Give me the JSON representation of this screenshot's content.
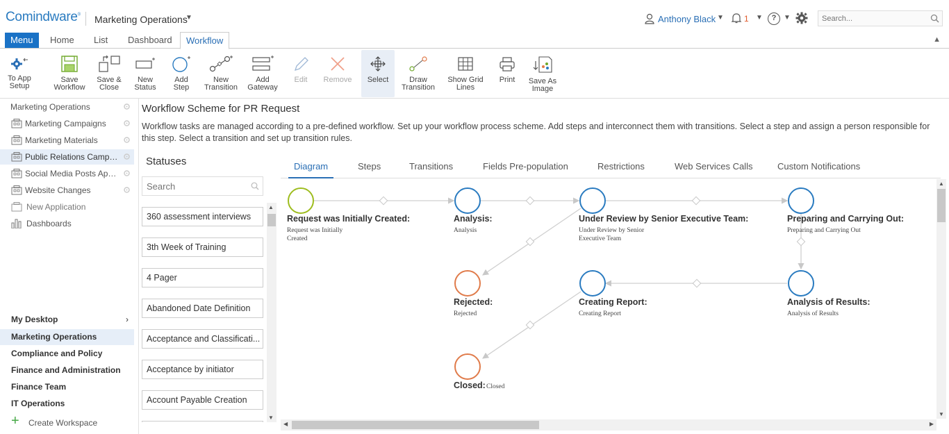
{
  "header": {
    "logo": "Comindware",
    "workspace_title": "Marketing Operations",
    "user_name": "Anthony Black",
    "notifications_count": "1",
    "search_placeholder": "Search..."
  },
  "tabs": {
    "menu": "Menu",
    "home": "Home",
    "list": "List",
    "dashboard": "Dashboard",
    "workflow": "Workflow"
  },
  "toolbar": {
    "to_app_setup_1": "To App",
    "to_app_setup_2": "Setup",
    "save_workflow_1": "Save",
    "save_workflow_2": "Workflow",
    "save_close_1": "Save &",
    "save_close_2": "Close",
    "new_status_1": "New",
    "new_status_2": "Status",
    "add_step_1": "Add",
    "add_step_2": "Step",
    "new_transition_1": "New",
    "new_transition_2": "Transition",
    "add_gateway_1": "Add",
    "add_gateway_2": "Gateway",
    "edit": "Edit",
    "remove": "Remove",
    "select": "Select",
    "draw_transition_1": "Draw",
    "draw_transition_2": "Transition",
    "show_grid_1": "Show Grid",
    "show_grid_2": "Lines",
    "print": "Print",
    "save_image_1": "Save As",
    "save_image_2": "Image"
  },
  "leftnav": {
    "items": [
      {
        "label": "Marketing Operations"
      },
      {
        "label": "Marketing Campaigns"
      },
      {
        "label": "Marketing Materials"
      },
      {
        "label": "Public Relations Campai..."
      },
      {
        "label": "Social Media Posts Appr..."
      },
      {
        "label": "Website Changes"
      },
      {
        "label": "New Application"
      },
      {
        "label": "Dashboards"
      }
    ],
    "workspaces": [
      {
        "label": "My Desktop"
      },
      {
        "label": "Marketing Operations"
      },
      {
        "label": "Compliance and Policy"
      },
      {
        "label": "Finance and Administration"
      },
      {
        "label": "Finance Team"
      },
      {
        "label": "IT Operations"
      }
    ],
    "create_workspace": "Create Workspace"
  },
  "main": {
    "title": "Workflow Scheme for PR Request",
    "description": "Workflow tasks are managed according to a pre-defined workflow. Set up your workflow process scheme. Add steps and interconnect them with transitions. Select a step and assign a person responsible for this step. Select a transition and set up transition rules.",
    "statuses_title": "Statuses",
    "statuses_search_placeholder": "Search",
    "statuses": [
      "360 assessment interviews",
      "3th Week of Training",
      "4 Pager",
      "Abandoned Date Definition",
      "Acceptance and Classificati...",
      "Acceptance by initiator",
      "Account Payable Creation"
    ],
    "workflow_tabs": [
      "Diagram",
      "Steps",
      "Transitions",
      "Fields Pre-population",
      "Restrictions",
      "Web Services Calls",
      "Custom Notifications"
    ]
  },
  "diagram": {
    "nodes": [
      {
        "title": "Request was Initially Created:",
        "sub1": "Request was Initially",
        "sub2": "Created"
      },
      {
        "title": "Analysis:",
        "sub1": "Analysis",
        "sub2": ""
      },
      {
        "title": "Under Review by Senior Executive Team:",
        "sub1": "Under Review by Senior",
        "sub2": "Executive Team"
      },
      {
        "title": "Preparing and Carrying Out:",
        "sub1": "Preparing and Carrying Out",
        "sub2": ""
      },
      {
        "title": "Rejected:",
        "sub1": "Rejected",
        "sub2": ""
      },
      {
        "title": "Creating Report:",
        "sub1": "Creating Report",
        "sub2": ""
      },
      {
        "title": "Analysis of Results:",
        "sub1": "Analysis of Results",
        "sub2": ""
      },
      {
        "title": "Closed:",
        "sub1": "Closed",
        "sub2": ""
      }
    ]
  },
  "colors": {
    "accent": "#1a72c6",
    "start_node": "#9ebd1f",
    "step_node": "#2a7bc0",
    "end_node": "#e07b4a"
  }
}
